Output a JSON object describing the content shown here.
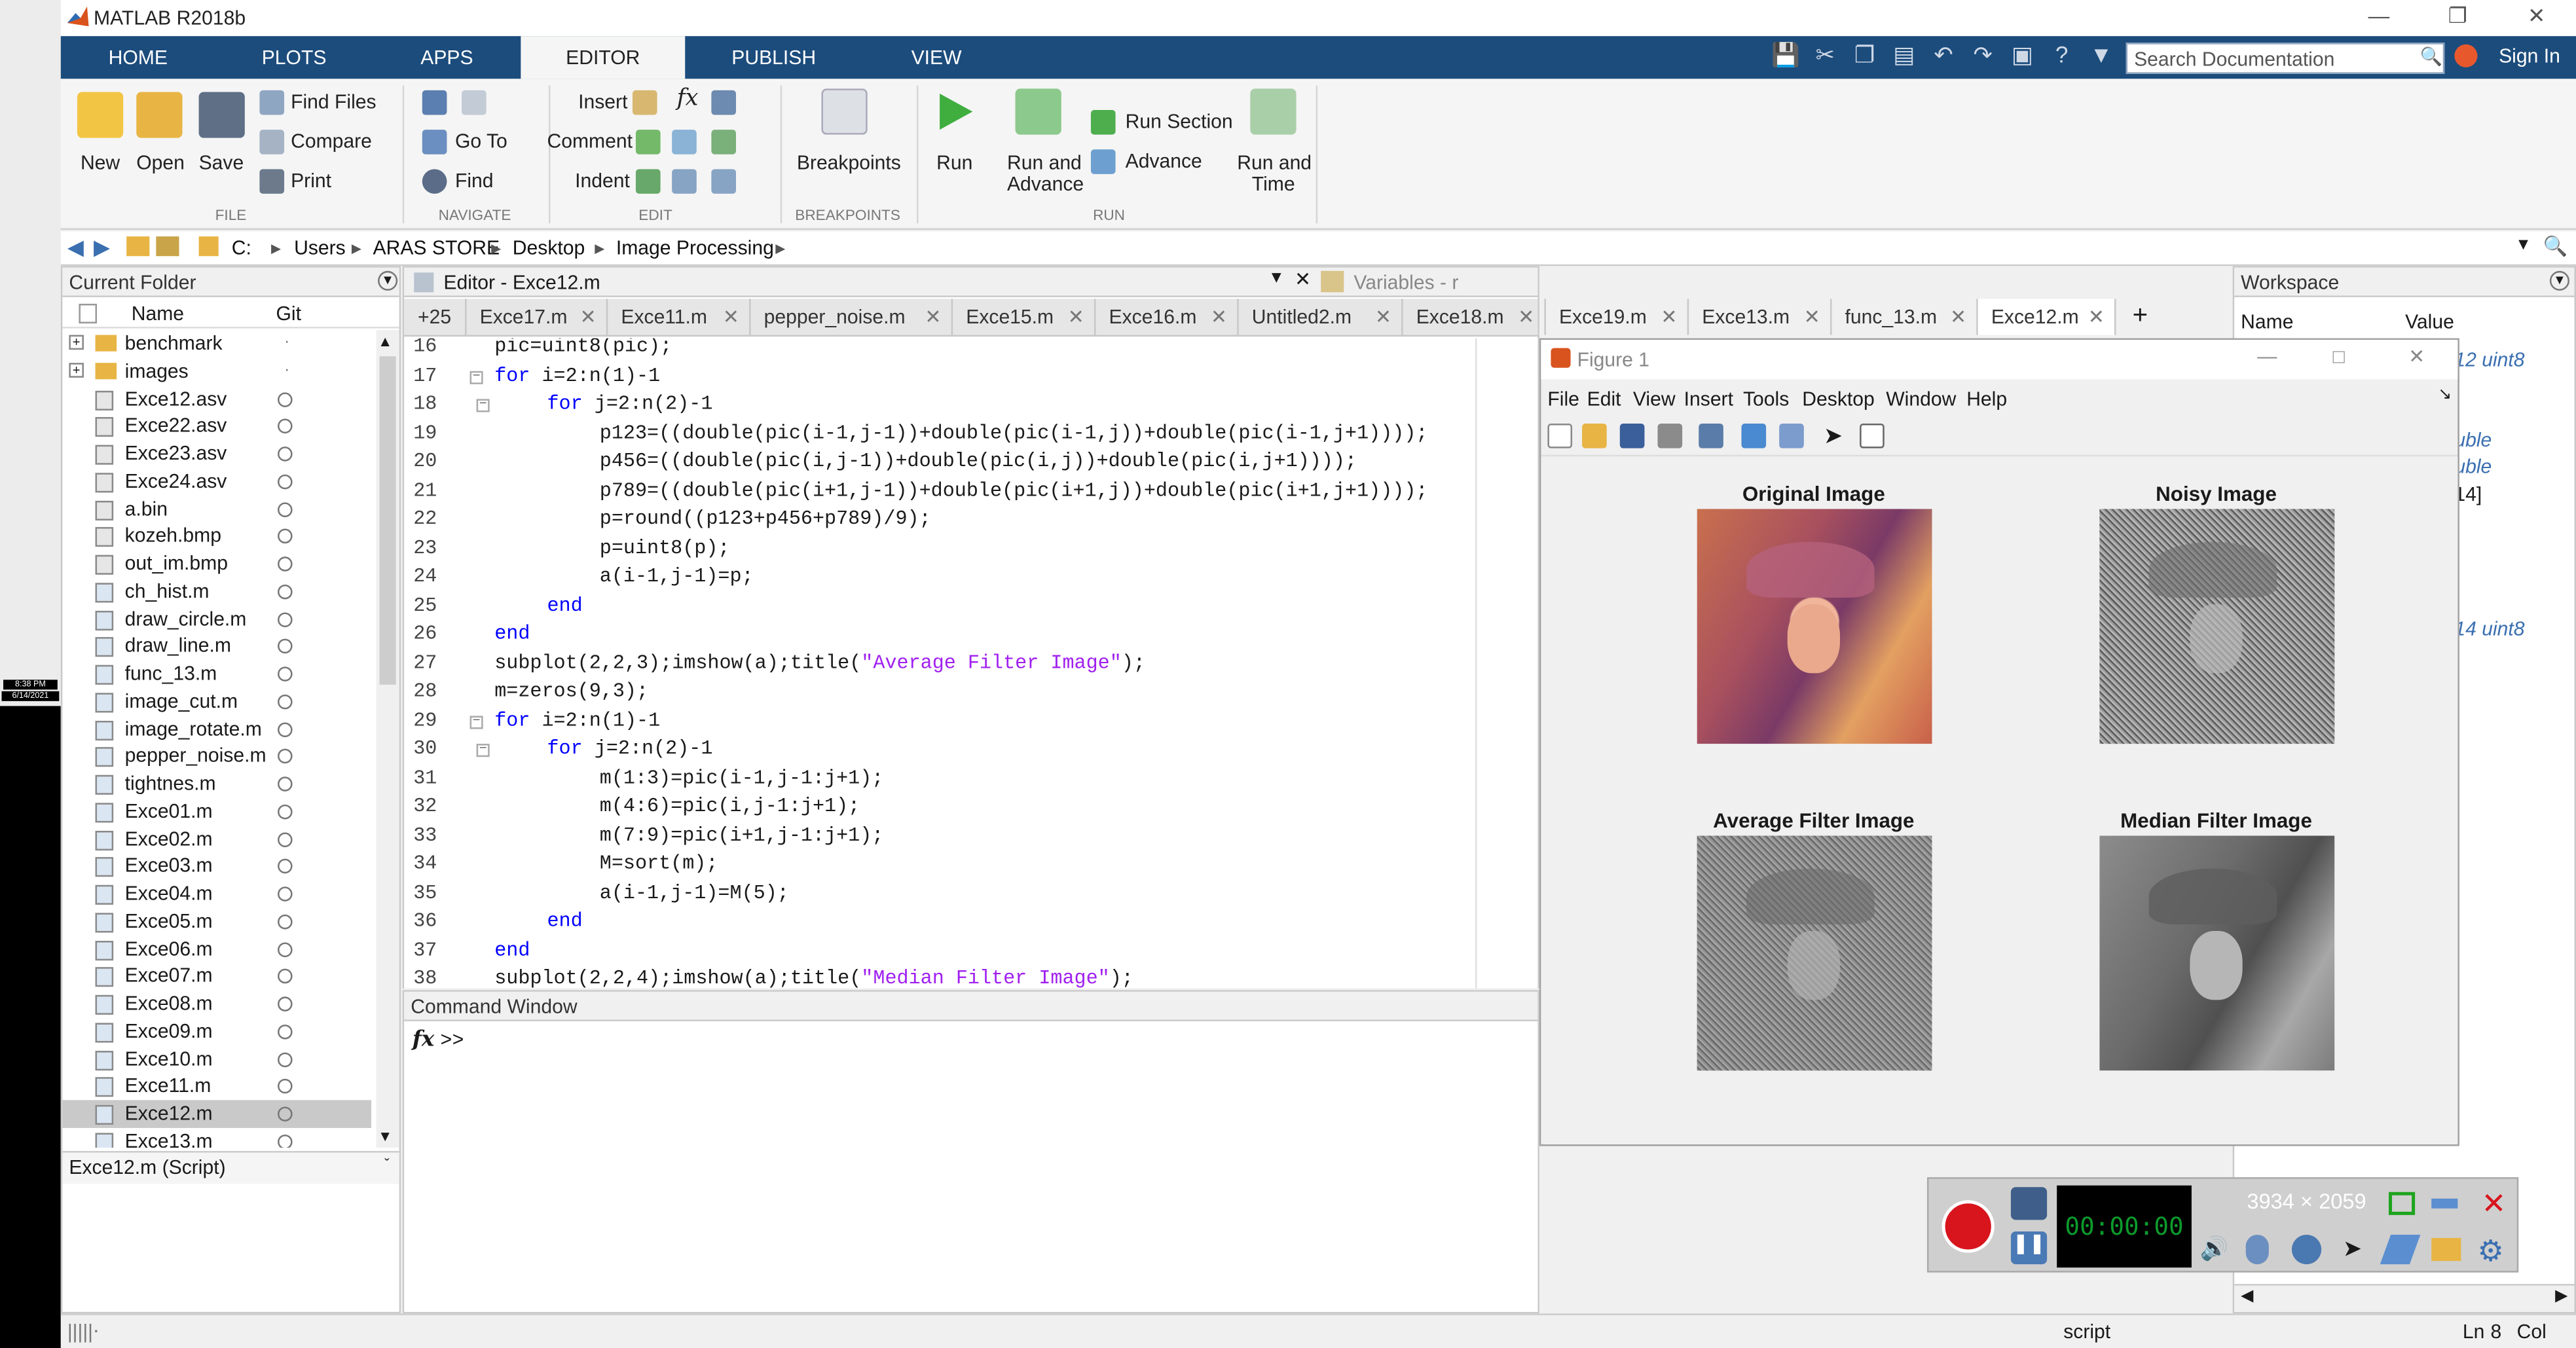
{
  "app": {
    "title": "MATLAB R2018b"
  },
  "main_tabs": [
    "HOME",
    "PLOTS",
    "APPS",
    "EDITOR",
    "PUBLISH",
    "VIEW"
  ],
  "search": {
    "placeholder": "Search Documentation"
  },
  "sign_in": "Sign In",
  "ribbon": {
    "file": {
      "new": "New",
      "open": "Open",
      "save": "Save",
      "find_files": "Find Files",
      "compare": "Compare",
      "print": "Print",
      "group": "FILE"
    },
    "navigate": {
      "go_to": "Go To",
      "find": "Find",
      "group": "NAVIGATE"
    },
    "edit": {
      "insert": "Insert",
      "comment": "Comment",
      "indent": "Indent",
      "group": "EDIT"
    },
    "breakpoints": {
      "label": "Breakpoints",
      "group": "BREAKPOINTS"
    },
    "run": {
      "run": "Run",
      "run_and": "Run and",
      "advance_word": "Advance",
      "run_section": "Run Section",
      "advance": "Advance",
      "run_and_time_1": "Run and",
      "run_and_time_2": "Time",
      "group": "RUN"
    }
  },
  "breadcrumb": [
    "C:",
    "Users",
    "ARAS STORE",
    "Desktop",
    "Image Processing"
  ],
  "current_folder": {
    "title": "Current Folder",
    "col_name": "Name",
    "col_git": "Git",
    "items": [
      {
        "name": "benchmark",
        "kind": "folder"
      },
      {
        "name": "images",
        "kind": "folder"
      },
      {
        "name": "Exce12.asv",
        "kind": "file"
      },
      {
        "name": "Exce22.asv",
        "kind": "file"
      },
      {
        "name": "Exce23.asv",
        "kind": "file"
      },
      {
        "name": "Exce24.asv",
        "kind": "file"
      },
      {
        "name": "a.bin",
        "kind": "file"
      },
      {
        "name": "kozeh.bmp",
        "kind": "file"
      },
      {
        "name": "out_im.bmp",
        "kind": "file"
      },
      {
        "name": "ch_hist.m",
        "kind": "m"
      },
      {
        "name": "draw_circle.m",
        "kind": "m"
      },
      {
        "name": "draw_line.m",
        "kind": "m"
      },
      {
        "name": "func_13.m",
        "kind": "m"
      },
      {
        "name": "image_cut.m",
        "kind": "m"
      },
      {
        "name": "image_rotate.m",
        "kind": "m"
      },
      {
        "name": "pepper_noise.m",
        "kind": "m"
      },
      {
        "name": "tightnes.m",
        "kind": "m"
      },
      {
        "name": "Exce01.m",
        "kind": "m"
      },
      {
        "name": "Exce02.m",
        "kind": "m"
      },
      {
        "name": "Exce03.m",
        "kind": "m"
      },
      {
        "name": "Exce04.m",
        "kind": "m"
      },
      {
        "name": "Exce05.m",
        "kind": "m"
      },
      {
        "name": "Exce06.m",
        "kind": "m"
      },
      {
        "name": "Exce07.m",
        "kind": "m"
      },
      {
        "name": "Exce08.m",
        "kind": "m"
      },
      {
        "name": "Exce09.m",
        "kind": "m"
      },
      {
        "name": "Exce10.m",
        "kind": "m"
      },
      {
        "name": "Exce11.m",
        "kind": "m"
      },
      {
        "name": "Exce12.m",
        "kind": "m",
        "selected": true
      },
      {
        "name": "Exce13.m",
        "kind": "m"
      }
    ],
    "footer": "Exce12.m  (Script)"
  },
  "editor": {
    "title": "Editor - Exce12.m",
    "variables_title": "Variables - r",
    "more_tabs": "+25",
    "tabs": [
      "Exce17.m",
      "Exce11.m",
      "pepper_noise.m",
      "Exce15.m",
      "Exce16.m",
      "Untitled2.m",
      "Exce18.m",
      "Exce19.m",
      "Exce13.m",
      "func_13.m",
      "Exce12.m"
    ],
    "active_tab": "Exce12.m",
    "lines": [
      {
        "n": "16",
        "segs": [
          {
            "t": "pic=uint8(pic);"
          }
        ],
        "indent": 0
      },
      {
        "n": "17",
        "segs": [
          {
            "t": "for ",
            "c": "kw"
          },
          {
            "t": "i=2:n(1)-1"
          }
        ],
        "indent": 0,
        "fold": true
      },
      {
        "n": "18",
        "segs": [
          {
            "t": "for ",
            "c": "kw"
          },
          {
            "t": "j=2:n(2)-1"
          }
        ],
        "indent": 1,
        "fold": true
      },
      {
        "n": "19",
        "segs": [
          {
            "t": "p123=((double(pic(i-1,j-1))+double(pic(i-1,j))+double(pic(i-1,j+1))));"
          }
        ],
        "indent": 2
      },
      {
        "n": "20",
        "segs": [
          {
            "t": "p456=((double(pic(i,j-1))+double(pic(i,j))+double(pic(i,j+1))));"
          }
        ],
        "indent": 2
      },
      {
        "n": "21",
        "segs": [
          {
            "t": "p789=((double(pic(i+1,j-1))+double(pic(i+1,j))+double(pic(i+1,j+1))));"
          }
        ],
        "indent": 2
      },
      {
        "n": "22",
        "segs": [
          {
            "t": "p=round((p123+p456+p789)/9);"
          }
        ],
        "indent": 2
      },
      {
        "n": "23",
        "segs": [
          {
            "t": "p=uint8(p);"
          }
        ],
        "indent": 2
      },
      {
        "n": "24",
        "segs": [
          {
            "t": "a(i-1,j-1)=p;"
          }
        ],
        "indent": 2
      },
      {
        "n": "25",
        "segs": [
          {
            "t": "end",
            "c": "kw"
          }
        ],
        "indent": 1
      },
      {
        "n": "26",
        "segs": [
          {
            "t": "end",
            "c": "kw"
          }
        ],
        "indent": 0
      },
      {
        "n": "27",
        "segs": [
          {
            "t": "subplot(2,2,3);imshow(a);title("
          },
          {
            "t": "\"Average Filter Image\"",
            "c": "str"
          },
          {
            "t": ");"
          }
        ],
        "indent": 0
      },
      {
        "n": "28",
        "segs": [
          {
            "t": "m=zeros(9,3);"
          }
        ],
        "indent": 0
      },
      {
        "n": "29",
        "segs": [
          {
            "t": "for ",
            "c": "kw"
          },
          {
            "t": "i=2:n(1)-1"
          }
        ],
        "indent": 0,
        "fold": true
      },
      {
        "n": "30",
        "segs": [
          {
            "t": "for ",
            "c": "kw"
          },
          {
            "t": "j=2:n(2)-1"
          }
        ],
        "indent": 1,
        "fold": true
      },
      {
        "n": "31",
        "segs": [
          {
            "t": "m(1:3)=pic(i-1,j-1:j+1);"
          }
        ],
        "indent": 2
      },
      {
        "n": "32",
        "segs": [
          {
            "t": "m(4:6)=pic(i,j-1:j+1);"
          }
        ],
        "indent": 2
      },
      {
        "n": "33",
        "segs": [
          {
            "t": "m(7:9)=pic(i+1,j-1:j+1);"
          }
        ],
        "indent": 2
      },
      {
        "n": "34",
        "segs": [
          {
            "t": "M=sort(m);"
          }
        ],
        "indent": 2
      },
      {
        "n": "35",
        "segs": [
          {
            "t": "a(i-1,j-1)=M(5);"
          }
        ],
        "indent": 2
      },
      {
        "n": "36",
        "segs": [
          {
            "t": "end",
            "c": "kw"
          }
        ],
        "indent": 1
      },
      {
        "n": "37",
        "segs": [
          {
            "t": "end",
            "c": "kw"
          }
        ],
        "indent": 0
      },
      {
        "n": "38",
        "segs": [
          {
            "t": "subplot(2,2,4);imshow(a);title("
          },
          {
            "t": "\"Median Filter Image\"",
            "c": "str"
          },
          {
            "t": ");"
          }
        ],
        "indent": 0
      }
    ]
  },
  "command_window": {
    "title": "Command Window",
    "fx": "fx",
    "prompt": ">>"
  },
  "workspace": {
    "title": "Workspace",
    "col_name": "Name",
    "col_value": "Value",
    "peek": [
      "12 uint8",
      "uble",
      "uble",
      "14]",
      "14 uint8"
    ]
  },
  "figure": {
    "title": "Figure 1",
    "menu": [
      "File",
      "Edit",
      "View",
      "Insert",
      "Tools",
      "Desktop",
      "Window",
      "Help"
    ],
    "subplots": [
      {
        "title": "Original Image",
        "kind": "color"
      },
      {
        "title": "Noisy Image",
        "kind": "noisy"
      },
      {
        "title": "Average Filter Image",
        "kind": "avg"
      },
      {
        "title": "Median Filter Image",
        "kind": "median"
      }
    ]
  },
  "recorder": {
    "resolution": "3934 × 2059"
  },
  "status": {
    "mode": "script",
    "ln": "Ln",
    "ln_value": "8",
    "col": "Col"
  },
  "taskbar_clock": {
    "time": "8:38 PM",
    "date": "6/14/2021"
  },
  "colors": {
    "tabbar": "#1c4c7c",
    "keyword": "#0000ff",
    "string": "#a020f0",
    "selection": "#c9c9c9"
  }
}
